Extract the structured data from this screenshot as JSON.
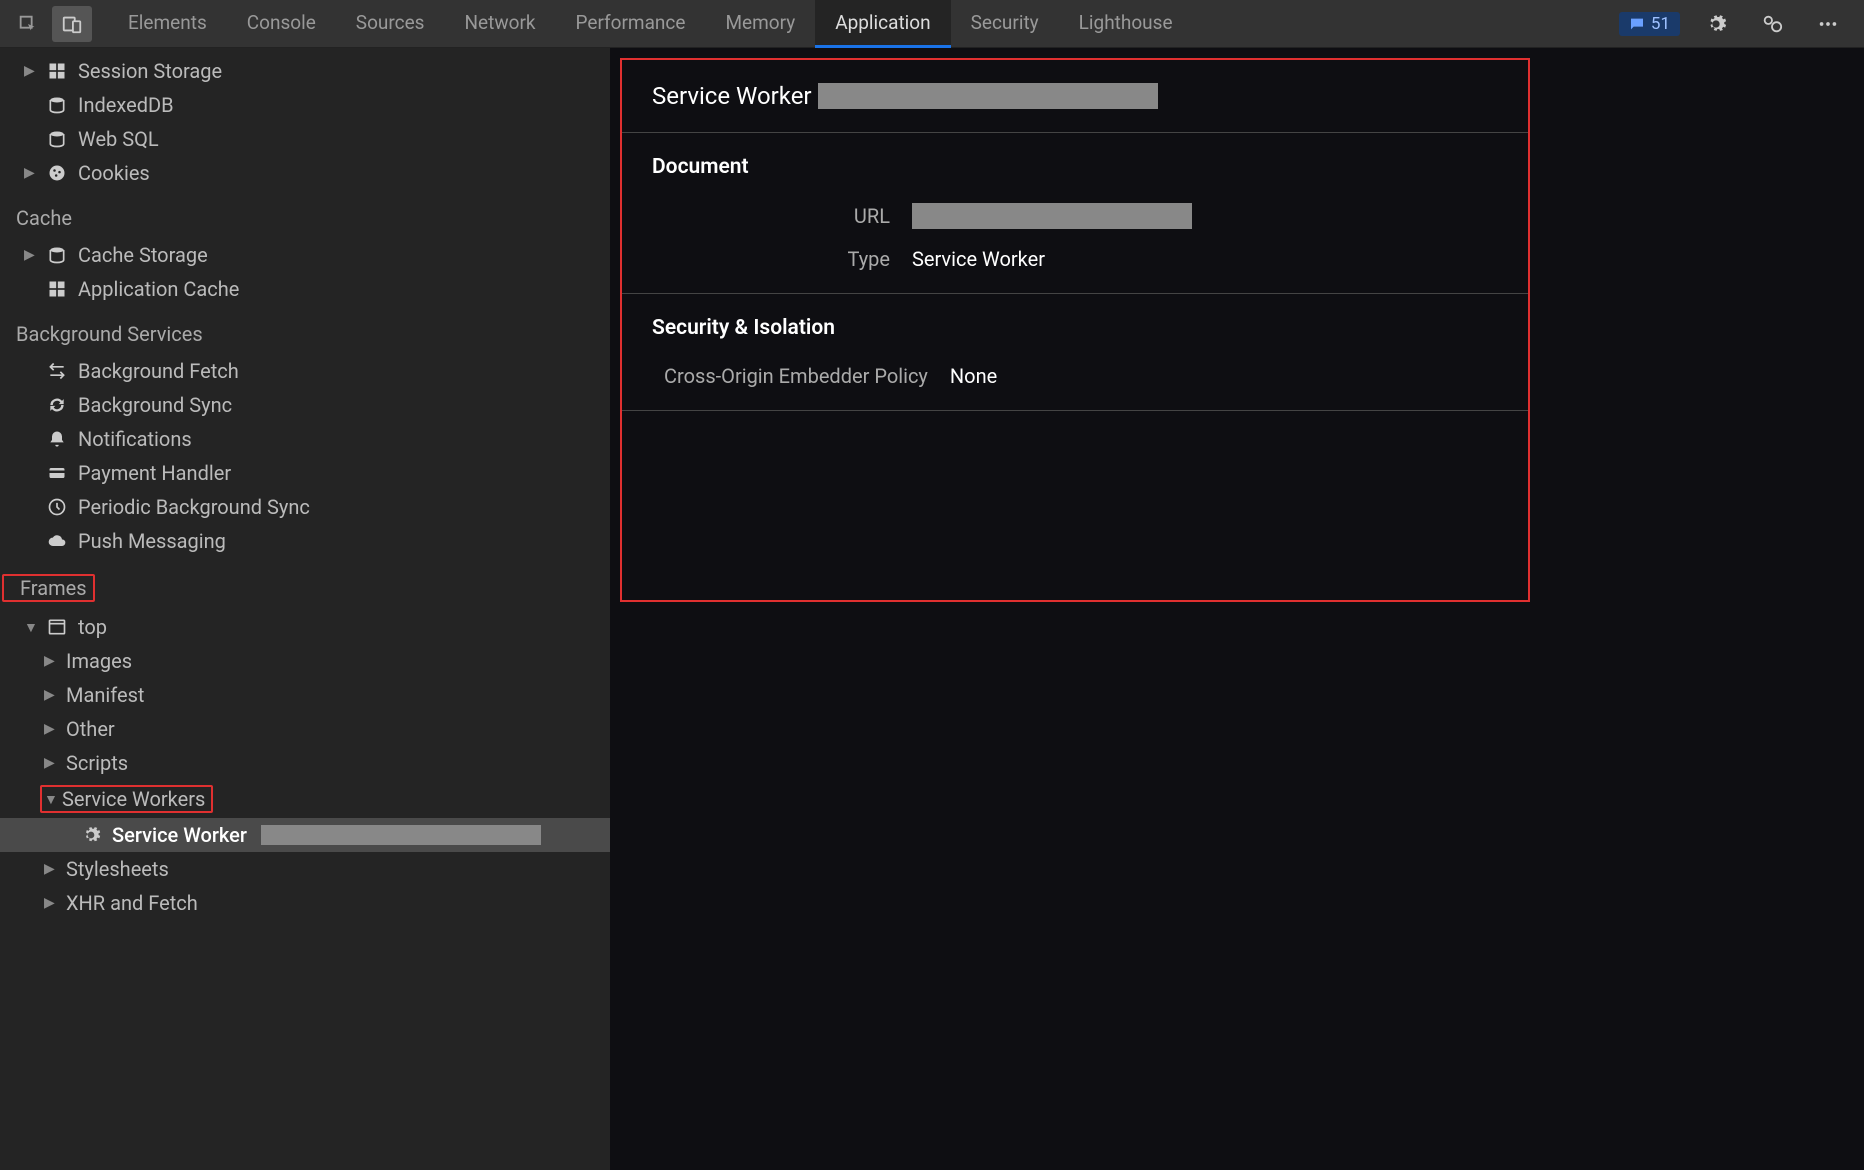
{
  "topbar": {
    "tabs": [
      "Elements",
      "Console",
      "Sources",
      "Network",
      "Performance",
      "Memory",
      "Application",
      "Security",
      "Lighthouse"
    ],
    "active_tab": "Application",
    "error_count": "51"
  },
  "sidebar": {
    "storage_items": [
      {
        "label": "Session Storage",
        "icon": "grid",
        "expandable": true
      },
      {
        "label": "IndexedDB",
        "icon": "db"
      },
      {
        "label": "Web SQL",
        "icon": "db"
      },
      {
        "label": "Cookies",
        "icon": "cookie",
        "expandable": true
      }
    ],
    "cache_header": "Cache",
    "cache_items": [
      {
        "label": "Cache Storage",
        "icon": "db",
        "expandable": true
      },
      {
        "label": "Application Cache",
        "icon": "grid"
      }
    ],
    "bg_header": "Background Services",
    "bg_items": [
      {
        "label": "Background Fetch",
        "icon": "fetch"
      },
      {
        "label": "Background Sync",
        "icon": "sync"
      },
      {
        "label": "Notifications",
        "icon": "bell"
      },
      {
        "label": "Payment Handler",
        "icon": "card"
      },
      {
        "label": "Periodic Background Sync",
        "icon": "clock"
      },
      {
        "label": "Push Messaging",
        "icon": "cloud"
      }
    ],
    "frames_header": "Frames",
    "frames": {
      "root": "top",
      "children": [
        "Images",
        "Manifest",
        "Other",
        "Scripts"
      ],
      "sw_group": "Service Workers",
      "sw_item": "Service Worker",
      "tail": [
        "Stylesheets",
        "XHR and Fetch"
      ]
    }
  },
  "main": {
    "header_title": "Service Worker",
    "document_header": "Document",
    "url_label": "URL",
    "type_label": "Type",
    "type_value": "Service Worker",
    "security_header": "Security & Isolation",
    "coep_label": "Cross-Origin Embedder Policy",
    "coep_value": "None"
  }
}
